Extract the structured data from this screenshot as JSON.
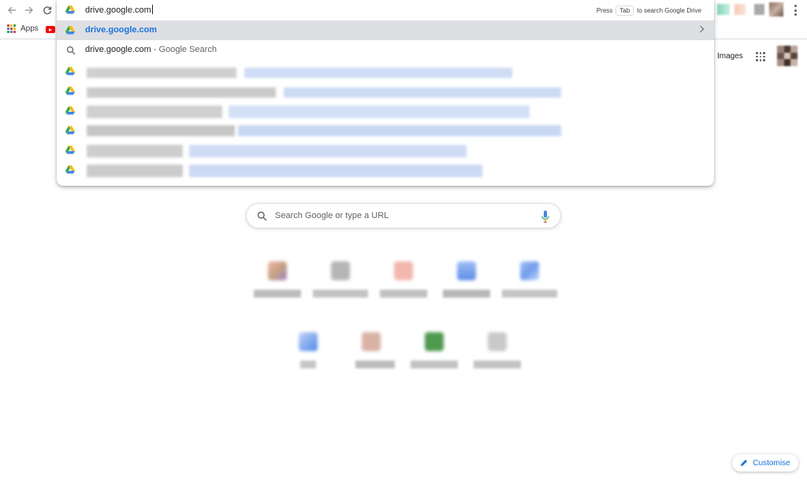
{
  "omnibox": {
    "typed_text": "drive.google.com",
    "hint_press": "Press",
    "hint_key": "Tab",
    "hint_action": "to search Google Drive",
    "suggestions": [
      {
        "text": "drive.google.com",
        "type": "url",
        "icon": "google-drive-icon"
      },
      {
        "text": "drive.google.com",
        "suffix": " - Google Search",
        "type": "search",
        "icon": "search-icon"
      }
    ]
  },
  "bookmarks": {
    "apps_label": "Apps"
  },
  "ntp": {
    "images_link": "Images",
    "search_placeholder": "Search Google or type a URL",
    "customise_label": "Customise"
  },
  "colors": {
    "accent": "#1a73e8",
    "selected_row": "#dedfe2"
  }
}
